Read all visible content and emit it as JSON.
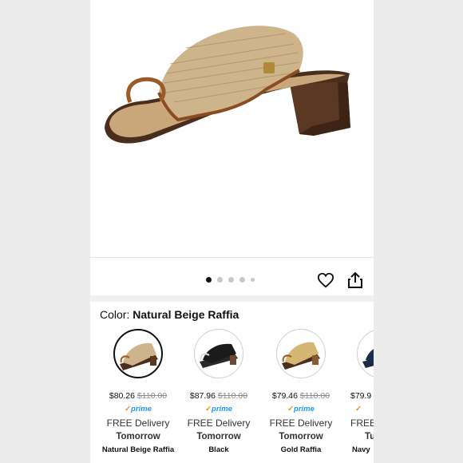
{
  "gallery": {
    "image_alt": "Raffia toe-loop block heel sandal",
    "dot_count": 5,
    "active_dot": 0
  },
  "colors": {
    "heart": "#111111",
    "accent_prime": "#1a98ff",
    "prime_check": "#f08804"
  },
  "color_selector": {
    "label": "Color:",
    "selected": "Natural Beige Raffia",
    "options": [
      {
        "price": "$80.26",
        "list_price": "$110.00",
        "prime": "prime",
        "delivery": "FREE Delivery",
        "when": "Tomorrow",
        "name": "Natural Beige Raffia",
        "selected": true
      },
      {
        "price": "$87.96",
        "list_price": "$110.00",
        "prime": "prime",
        "delivery": "FREE Delivery",
        "when": "Tomorrow",
        "name": "Black",
        "selected": false
      },
      {
        "price": "$79.46",
        "list_price": "$110.00",
        "prime": "prime",
        "delivery": "FREE Delivery",
        "when": "Tomorrow",
        "name": "Gold Raffia",
        "selected": false
      },
      {
        "price": "$79.9",
        "list_price": "",
        "prime": "",
        "delivery": "FREE",
        "when": "Tu",
        "name": "Navy",
        "selected": false
      }
    ]
  }
}
